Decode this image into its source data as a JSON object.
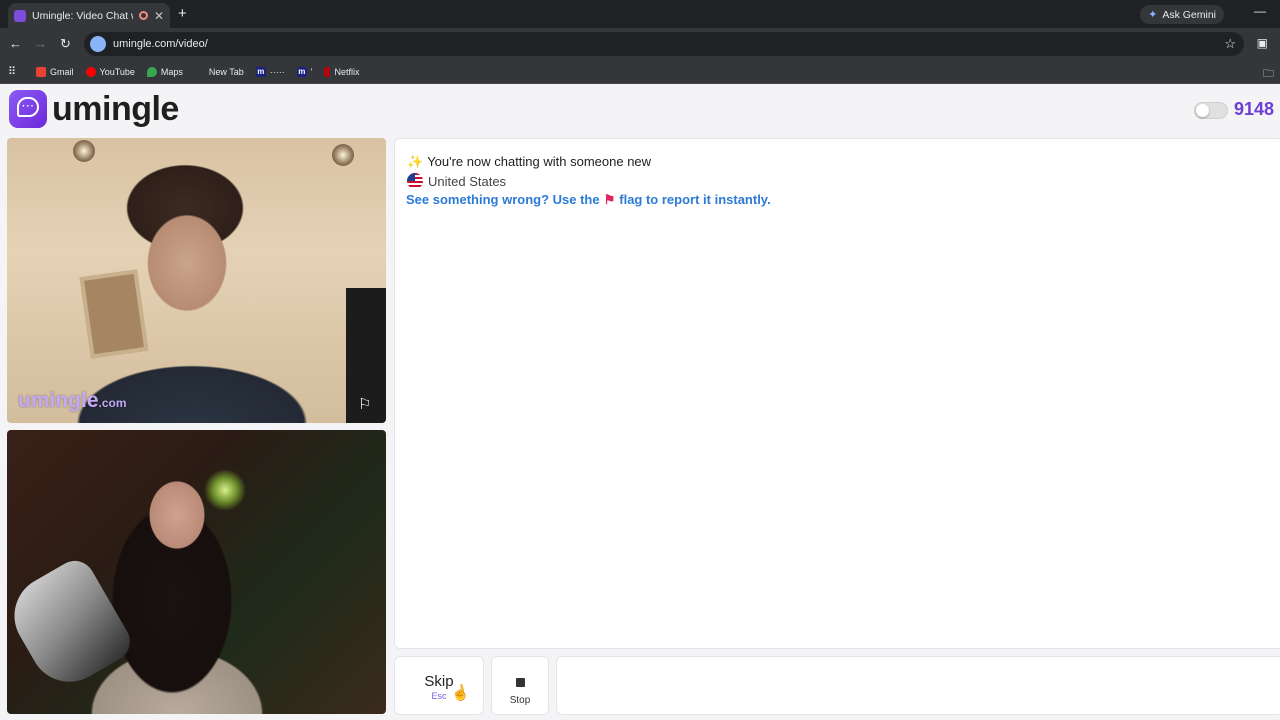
{
  "browser": {
    "tab_title": "Umingle: Video Chat with S",
    "new_tab_symbol": "+",
    "ask_gemini": "Ask Gemini",
    "url": "umingle.com/video/",
    "bookmarks": [
      {
        "label": "Gmail",
        "color": "#ea4335"
      },
      {
        "label": "YouTube",
        "color": "#ff0000"
      },
      {
        "label": "Maps",
        "color": "#34a853"
      },
      {
        "label": "New Tab",
        "color": "#35363a"
      },
      {
        "label": "·····",
        "color": "#1a237e"
      },
      {
        "label": "'",
        "color": "#1a237e"
      },
      {
        "label": "Netflix",
        "color": "#b20710"
      }
    ]
  },
  "header": {
    "logo_text": "umingle",
    "online_count": "9148"
  },
  "video": {
    "watermark_main": "umingle",
    "watermark_suffix": ".com"
  },
  "chat": {
    "system_message": "You're now chatting with someone new",
    "country": "United States",
    "report_prefix": "See something wrong? Use the",
    "report_suffix": "flag to report it instantly."
  },
  "controls": {
    "skip_label": "Skip",
    "skip_key": "Esc",
    "stop_label": "Stop"
  },
  "colors": {
    "brand": "#6d3fd6",
    "link": "#2d7bd6"
  }
}
